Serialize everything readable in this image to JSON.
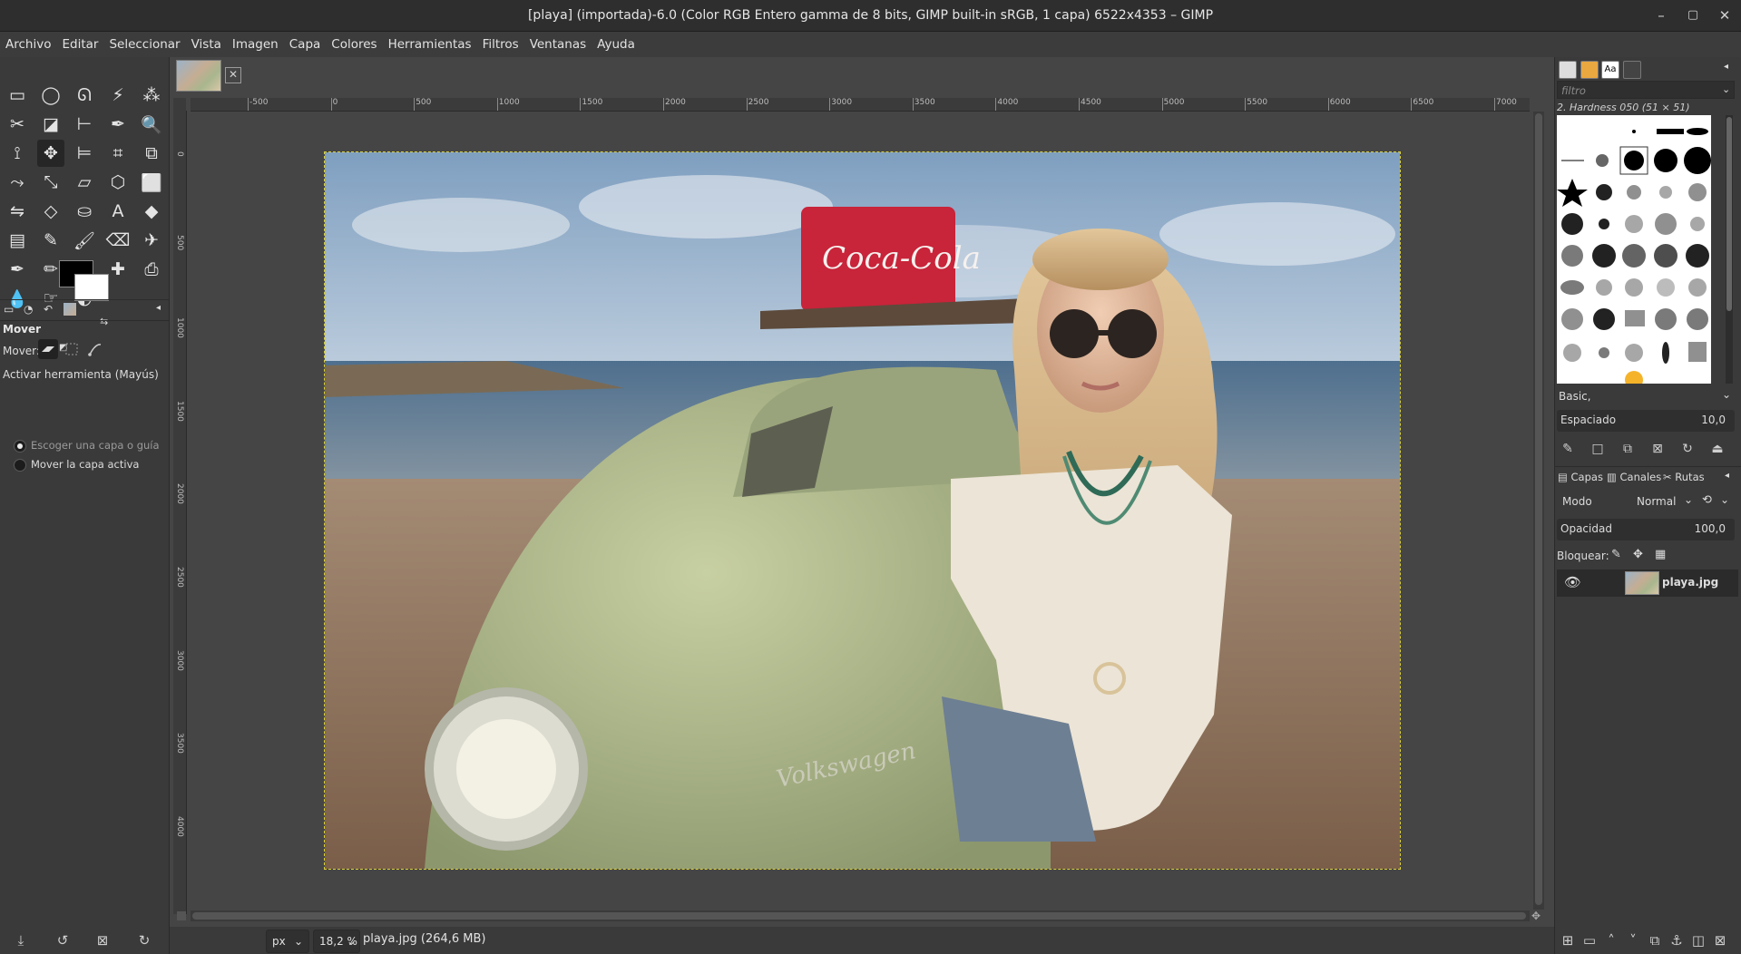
{
  "window": {
    "title": "[playa] (importada)-6.0 (Color RGB Entero gamma de 8 bits, GIMP built-in sRGB, 1 capa) 6522x4353 – GIMP",
    "controls": [
      "–",
      "▢",
      "✕"
    ]
  },
  "menu": [
    "Archivo",
    "Editar",
    "Seleccionar",
    "Vista",
    "Imagen",
    "Capa",
    "Colores",
    "Herramientas",
    "Filtros",
    "Ventanas",
    "Ayuda"
  ],
  "toolbox": {
    "tools": [
      "rect-select-icon",
      "ellipse-select-icon",
      "free-select-icon",
      "fuzzy-select-icon",
      "by-color-select-icon",
      "scissors-select-icon",
      "foreground-select-icon",
      "align-icon",
      "color-picker-icon",
      "zoom-icon",
      "paths-icon",
      "move-icon",
      "align-distribute-icon",
      "crop-icon",
      "unified-transform-icon",
      "warp-transform-icon",
      "scale-icon",
      "shear-icon",
      "cage-transform-icon",
      "perspective-icon",
      "flip-icon",
      "handle-transform-icon",
      "bucket-fill-icon",
      "text-icon",
      "fill-icon",
      "gradient-icon",
      "pencil-icon",
      "paintbrush-icon",
      "eraser-icon",
      "airbrush-icon",
      "ink-icon",
      "mypaint-brush-icon",
      "clone-icon",
      "heal-icon",
      "perspective-clone-icon",
      "blur-icon",
      "smudge-icon",
      "dodge-burn-icon"
    ],
    "foreground_color": "#000000",
    "background_color": "#ffffff"
  },
  "tool_options": {
    "title": "Mover",
    "move_label": "Mover:",
    "activate_label": "Activar herramienta  (Mayús)",
    "option_pick": "Escoger una capa o guía",
    "option_active": "Mover la capa activa",
    "selected_option": "Escoger una capa o guía"
  },
  "image_tab": {
    "thumbnail": "playa-thumbnail"
  },
  "rulers": {
    "horizontal": [
      "-500",
      "0",
      "500",
      "1000",
      "1500",
      "2000",
      "2500",
      "3000",
      "3500",
      "4000",
      "4500",
      "5000",
      "5500",
      "6000",
      "6500",
      "7000"
    ],
    "vertical": [
      "0",
      "500",
      "1000",
      "1500",
      "2000",
      "2500",
      "3000",
      "3500",
      "4000"
    ]
  },
  "status": {
    "unit": "px",
    "zoom": "18,2 %",
    "text": "playa.jpg (264,6 MB)"
  },
  "brushes": {
    "filter_placeholder": "filtro",
    "current_brush": "2. Hardness 050 (51 × 51)",
    "preset": "Basic,",
    "spacing_label": "Espaciado",
    "spacing_value": "10,0"
  },
  "layers_panel": {
    "tabs": [
      "Capas",
      "Canales",
      "Rutas"
    ],
    "mode_label": "Modo",
    "mode_value": "Normal",
    "opacity_label": "Opacidad",
    "opacity_value": "100,0",
    "lock_label": "Bloquear:",
    "layers": [
      {
        "name": "playa.jpg",
        "visible": true
      }
    ]
  },
  "colors": {
    "accent_selection": "#d9d03a",
    "selected_tool_bg": "#262626"
  }
}
